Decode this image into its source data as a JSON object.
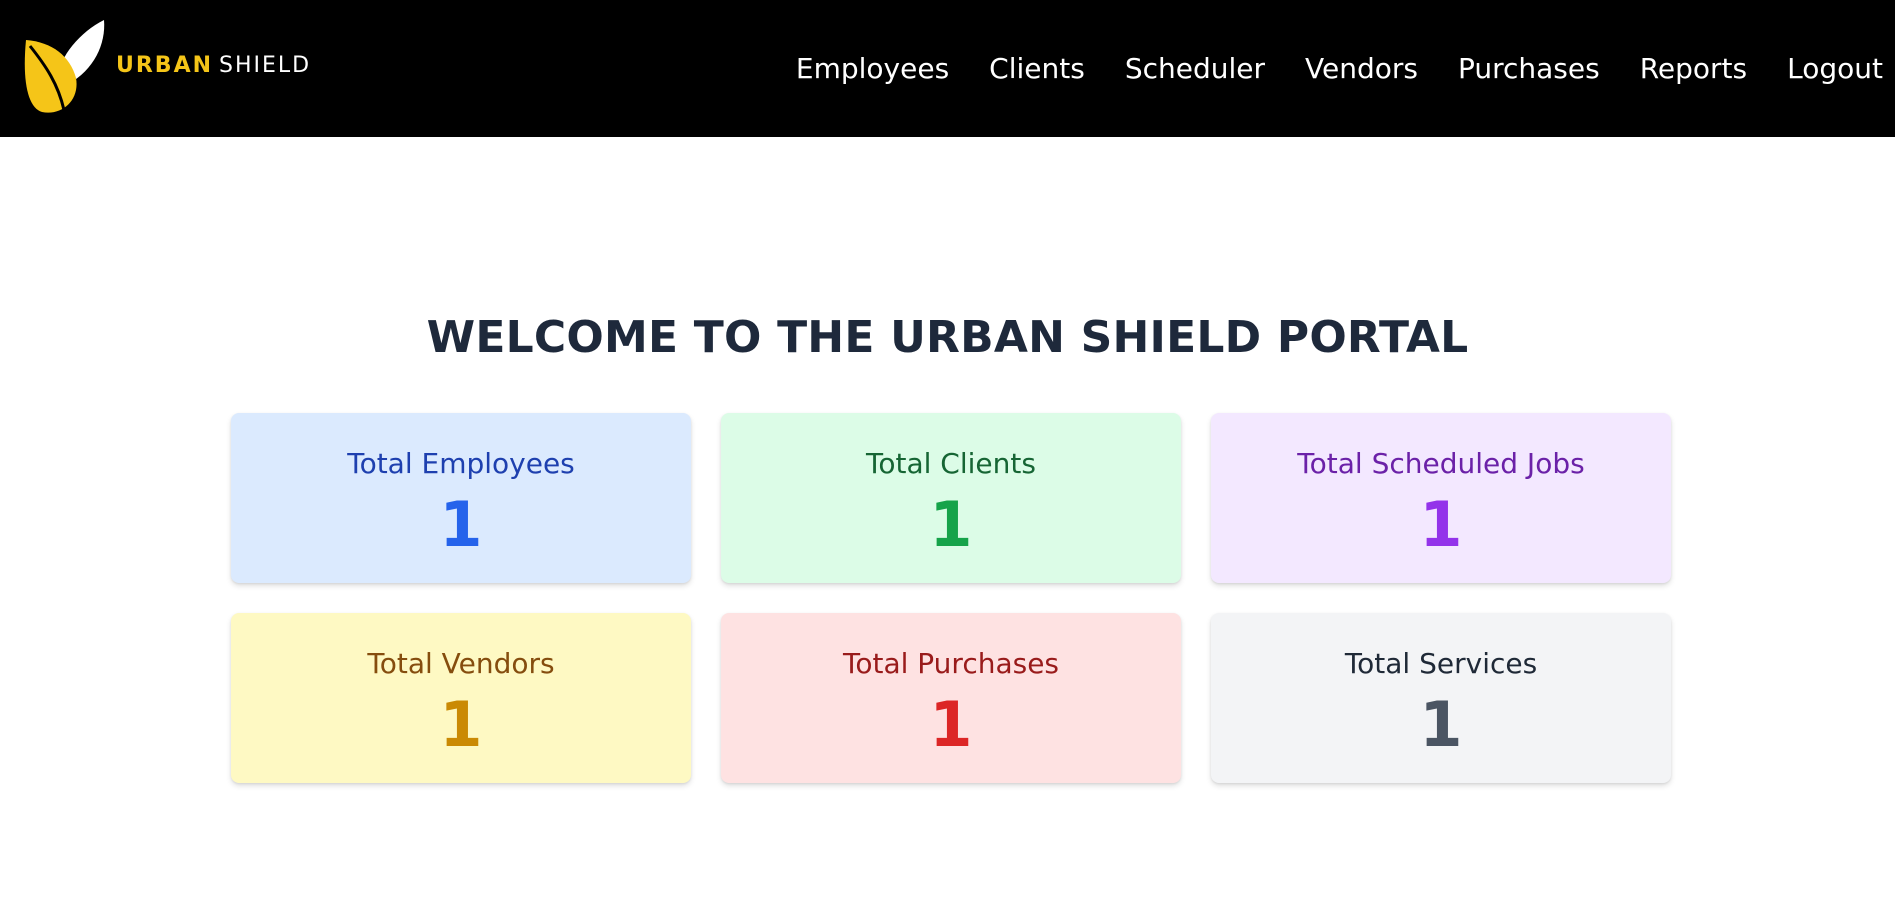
{
  "brand": {
    "name_part1": "URBAN",
    "name_part2": "SHIELD",
    "logo_icon": "leaf-logo-icon",
    "primary_color": "#f5c518"
  },
  "nav": {
    "items": [
      {
        "label": "Employees"
      },
      {
        "label": "Clients"
      },
      {
        "label": "Scheduler"
      },
      {
        "label": "Vendors"
      },
      {
        "label": "Purchases"
      },
      {
        "label": "Reports"
      },
      {
        "label": "Logout"
      }
    ]
  },
  "main": {
    "title": "WELCOME TO THE URBAN SHIELD PORTAL",
    "cards": [
      {
        "title": "Total Employees",
        "value": "1",
        "color": "#2563eb"
      },
      {
        "title": "Total Clients",
        "value": "1",
        "color": "#16a34a"
      },
      {
        "title": "Total Scheduled Jobs",
        "value": "1",
        "color": "#9333ea"
      },
      {
        "title": "Total Vendors",
        "value": "1",
        "color": "#ca8a04"
      },
      {
        "title": "Total Purchases",
        "value": "1",
        "color": "#dc2626"
      },
      {
        "title": "Total Services",
        "value": "1",
        "color": "#4b5563"
      }
    ]
  }
}
